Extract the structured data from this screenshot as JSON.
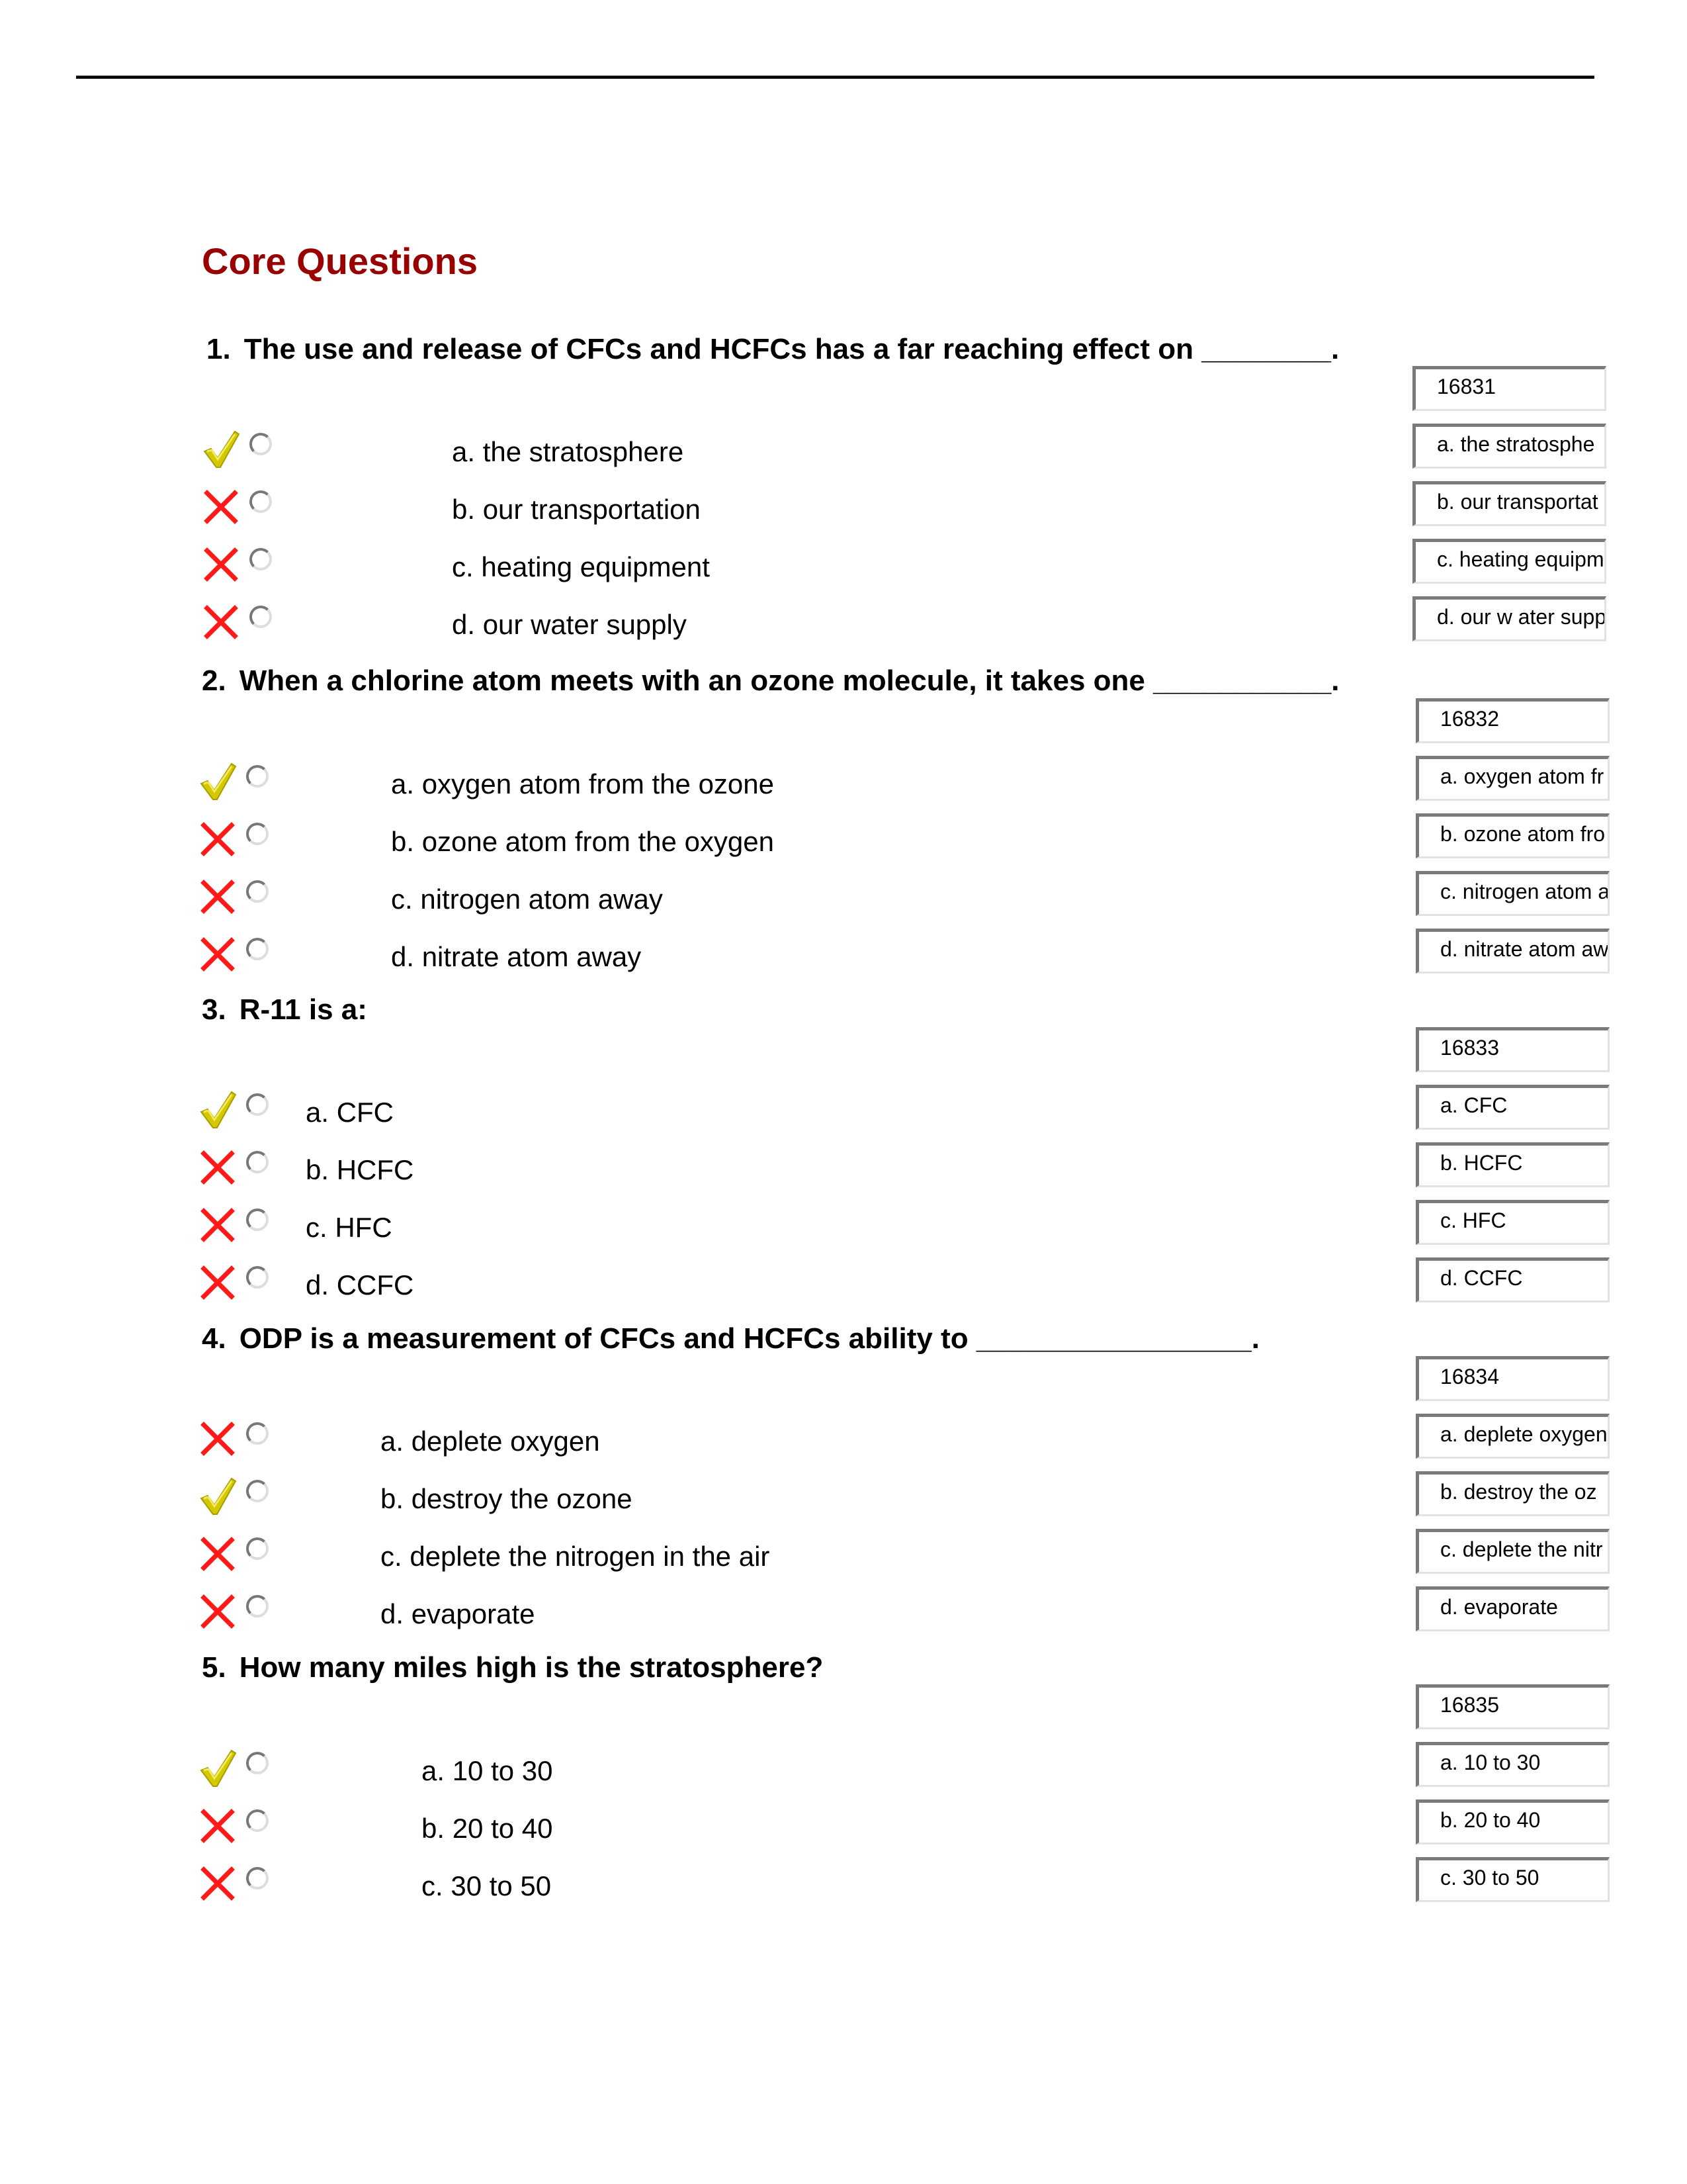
{
  "page": {
    "title": "Core Questions",
    "colors": {
      "title": "#990000",
      "correct_mark": "#d4c800",
      "wrong_mark": "#ff1a1a"
    }
  },
  "questions": [
    {
      "number": "1.",
      "text": "The use and release of CFCs and HCFCs has a far reaching effect on ________.",
      "id_box": "16831",
      "options": [
        {
          "label": "a. the stratosphere",
          "box": "a. the stratosphe",
          "mark": "check-icon"
        },
        {
          "label": "b. our transportation",
          "box": "b. our transportat",
          "mark": "x-icon"
        },
        {
          "label": "c. heating equipment",
          "box": "c. heating equipm",
          "mark": "x-icon"
        },
        {
          "label": "d. our water supply",
          "box": "d. our w ater supp",
          "mark": "x-icon"
        }
      ]
    },
    {
      "number": "2.",
      "text": "When a chlorine atom meets with an ozone molecule, it takes one ___________.",
      "id_box": "16832",
      "options": [
        {
          "label": "a. oxygen atom from the ozone",
          "box": "a. oxygen atom fr",
          "mark": "check-icon"
        },
        {
          "label": "b. ozone atom from the oxygen",
          "box": "b. ozone atom fro",
          "mark": "x-icon"
        },
        {
          "label": "c. nitrogen atom away",
          "box": "c. nitrogen atom a",
          "mark": "x-icon"
        },
        {
          "label": "d. nitrate atom away",
          "box": "d. nitrate atom aw",
          "mark": "x-icon"
        }
      ]
    },
    {
      "number": "3.",
      "text": "R-11 is a:",
      "id_box": "16833",
      "options": [
        {
          "label": "a. CFC",
          "box": "a. CFC",
          "mark": "check-icon"
        },
        {
          "label": "b. HCFC",
          "box": "b. HCFC",
          "mark": "x-icon"
        },
        {
          "label": "c. HFC",
          "box": "c. HFC",
          "mark": "x-icon"
        },
        {
          "label": "d. CCFC",
          "box": "d. CCFC",
          "mark": "x-icon"
        }
      ]
    },
    {
      "number": "4.",
      "text": "ODP is a measurement of CFCs and HCFCs ability to _________________.",
      "id_box": "16834",
      "options": [
        {
          "label": "a. deplete oxygen",
          "box": "a. deplete oxygen",
          "mark": "x-icon"
        },
        {
          "label": "b. destroy the ozone",
          "box": "b. destroy the oz",
          "mark": "check-icon"
        },
        {
          "label": "c. deplete the nitrogen in the air",
          "box": "c. deplete the nitr",
          "mark": "x-icon"
        },
        {
          "label": "d. evaporate",
          "box": "d. evaporate",
          "mark": "x-icon"
        }
      ]
    },
    {
      "number": "5.",
      "text": "How many miles high is the stratosphere?",
      "id_box": "16835",
      "options": [
        {
          "label": "a. 10 to 30",
          "box": "a. 10 to 30",
          "mark": "check-icon"
        },
        {
          "label": "b. 20 to 40",
          "box": "b. 20 to 40",
          "mark": "x-icon"
        },
        {
          "label": "c. 30 to 50",
          "box": "c. 30 to 50",
          "mark": "x-icon"
        }
      ]
    }
  ]
}
